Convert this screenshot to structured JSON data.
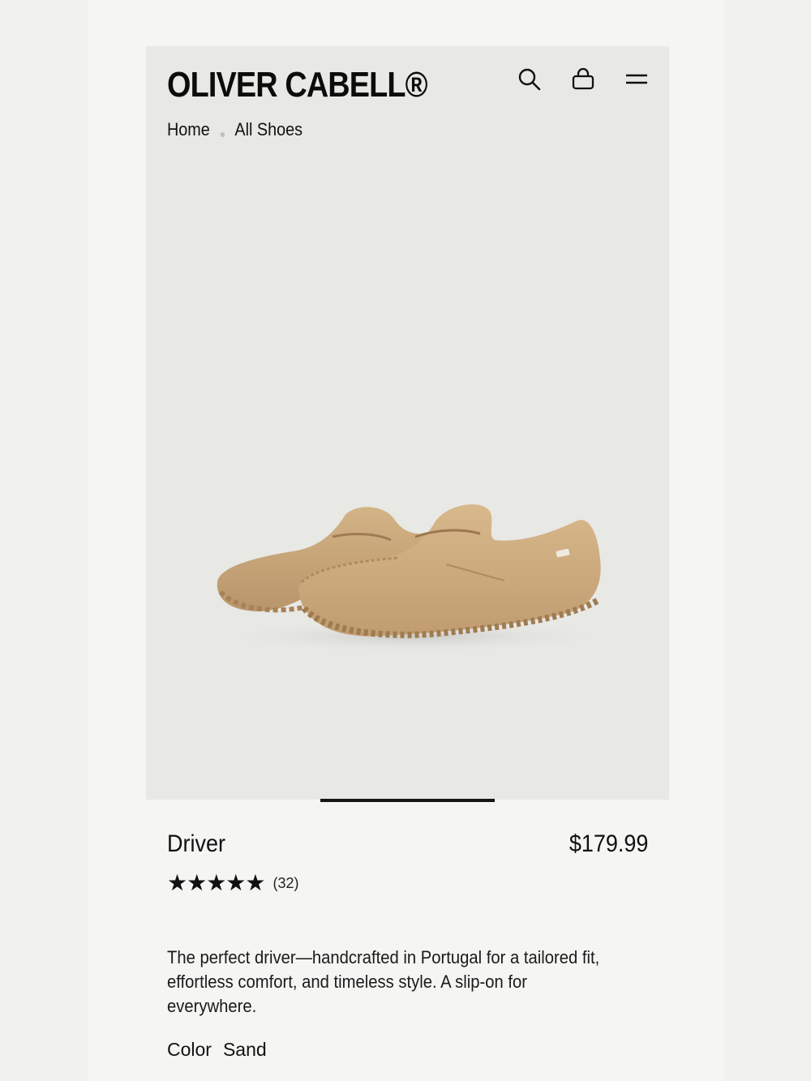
{
  "brand": {
    "logo_text": "OLIVER CABELL®"
  },
  "header": {
    "icons": [
      "search-icon",
      "bag-icon",
      "menu-icon"
    ]
  },
  "breadcrumb": {
    "items": [
      "Home",
      "All Shoes"
    ]
  },
  "carousel": {
    "current_slide": 1
  },
  "product": {
    "name": "Driver",
    "price": "$179.99",
    "rating_stars": "★★★★★",
    "rating_value": 5,
    "review_count": "(32)",
    "description": "The perfect driver—handcrafted in Portugal for a tailored fit, effortless comfort, and timeless style. A slip-on for everywhere.",
    "color_label": "Color",
    "color_value": "Sand"
  },
  "colors": {
    "page_bg": "#f5f5f3",
    "hero_bg": "#e8e8e5",
    "shoe": "#c9a77a",
    "text": "#111111"
  }
}
